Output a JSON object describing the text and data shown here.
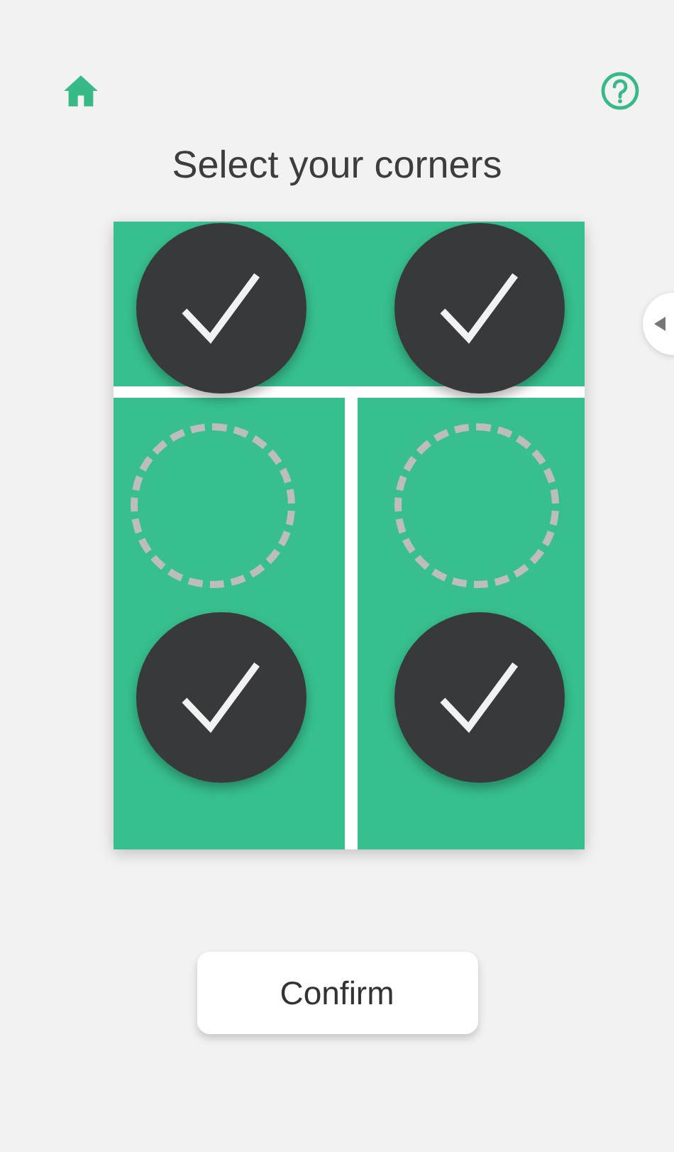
{
  "title": "Select your corners",
  "corners": [
    {
      "selected": true
    },
    {
      "selected": true
    },
    {
      "selected": false
    },
    {
      "selected": false
    },
    {
      "selected": true
    },
    {
      "selected": true
    }
  ],
  "confirm_button": {
    "label": "Confirm"
  }
}
